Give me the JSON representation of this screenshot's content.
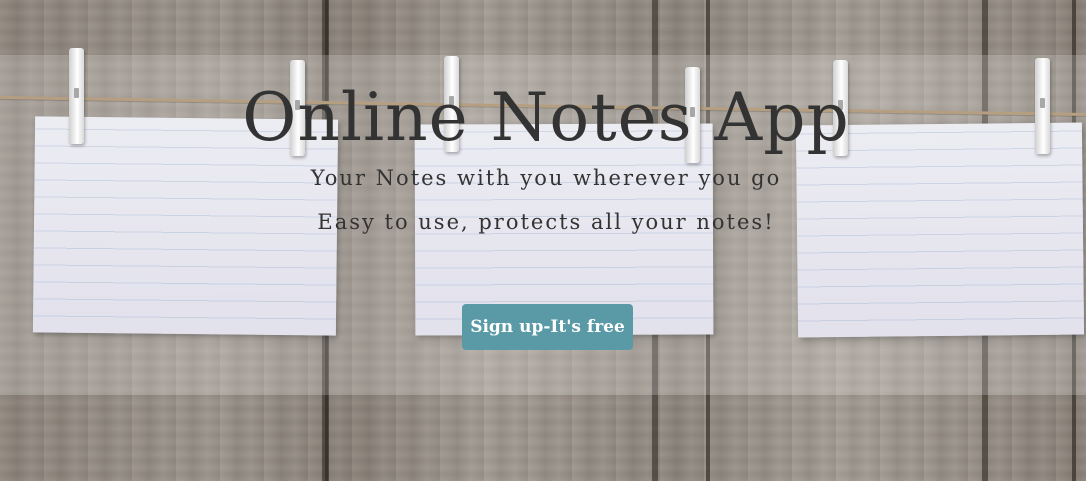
{
  "hero": {
    "title": "Online Notes App",
    "subtitle": "Your Notes with you wherever you go",
    "tagline": "Easy to use, protects all your notes!",
    "signup_label": "Sign up-It's free"
  },
  "colors": {
    "button_bg": "#5a9aa6",
    "button_text": "#ffffff",
    "heading_text": "#333333"
  }
}
